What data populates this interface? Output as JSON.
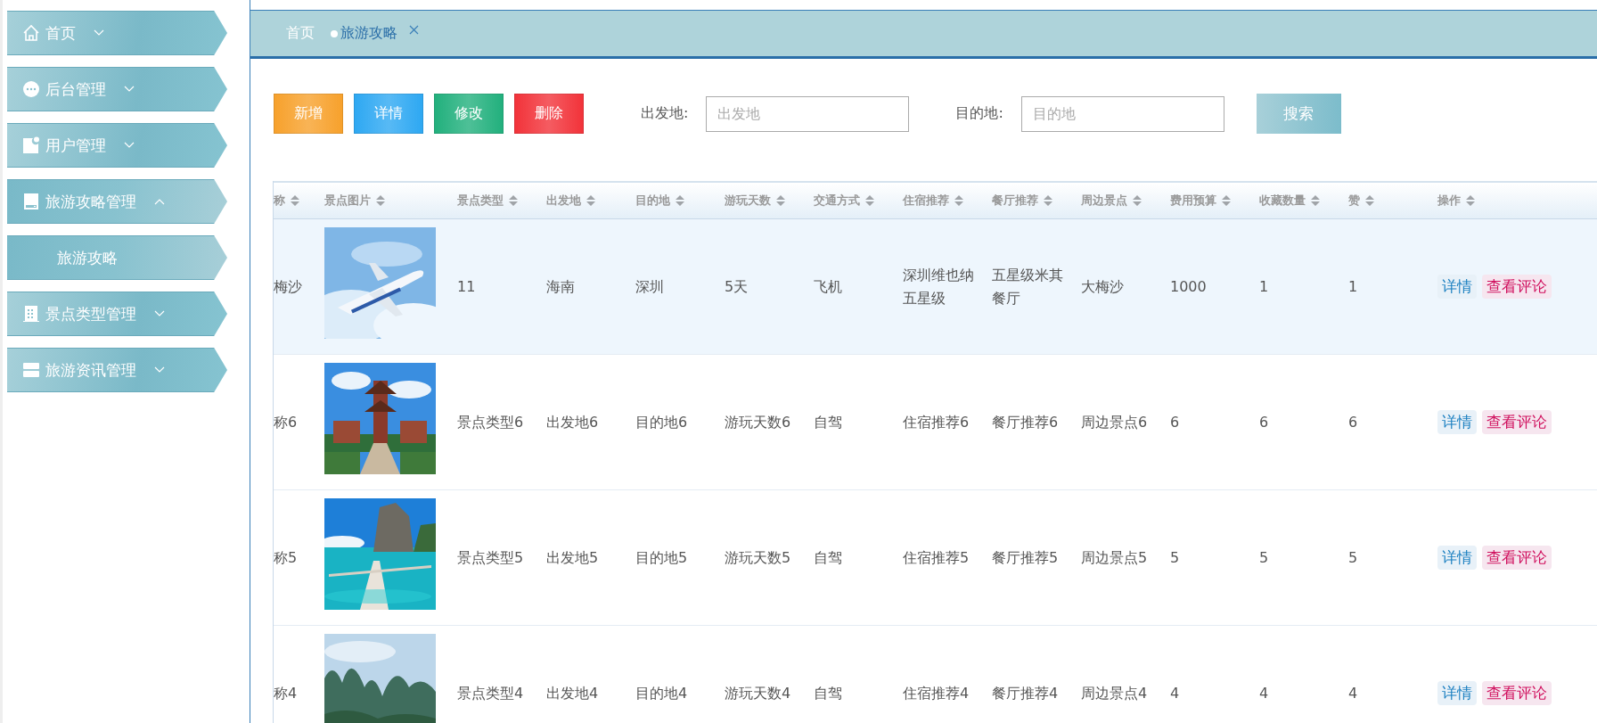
{
  "sidebar": {
    "items": [
      {
        "label": "首页",
        "expanded": false
      },
      {
        "label": "后台管理",
        "expanded": false
      },
      {
        "label": "用户管理",
        "expanded": false
      },
      {
        "label": "旅游攻略管理",
        "expanded": true,
        "children": [
          {
            "label": "旅游攻略",
            "selected": true
          }
        ]
      },
      {
        "label": "景点类型管理",
        "expanded": false
      },
      {
        "label": "旅游资讯管理",
        "expanded": false
      }
    ]
  },
  "tabs": [
    {
      "label": "首页",
      "selected": false,
      "closable": false
    },
    {
      "label": "旅游攻略",
      "selected": true,
      "closable": true
    }
  ],
  "toolbar": {
    "buttons": [
      {
        "label": "新增",
        "color": "#f7a12c"
      },
      {
        "label": "详情",
        "color": "#2ea8f2"
      },
      {
        "label": "修改",
        "color": "#22b07d"
      },
      {
        "label": "删除",
        "color": "#f2333a"
      }
    ],
    "filters": [
      {
        "label": "出发地:",
        "placeholder": "出发地"
      },
      {
        "label": "目的地:",
        "placeholder": "目的地"
      }
    ],
    "search_button": "搜索"
  },
  "table": {
    "columns": [
      "称",
      "景点图片",
      "景点类型",
      "出发地",
      "目的地",
      "游玩天数",
      "交通方式",
      "住宿推荐",
      "餐厅推荐",
      "周边景点",
      "费用预算",
      "收藏数量",
      "赞",
      "操作"
    ],
    "rows": [
      {
        "selected": true,
        "cells": [
          "梅沙",
          {
            "kind": "picture"
          },
          "11",
          "海南",
          "深圳",
          "5天",
          "飞机",
          "深圳维也纳五星级",
          "五星级米其餐厅",
          "大梅沙",
          "1000",
          "1",
          "1",
          {
            "actions": [
              "详情",
              "查看评论"
            ]
          }
        ]
      },
      {
        "selected": false,
        "cells": [
          "称6",
          {
            "kind": "picture"
          },
          "景点类型6",
          "出发地6",
          "目的地6",
          "游玩天数6",
          "自驾",
          "住宿推荐6",
          "餐厅推荐6",
          "周边景点6",
          "6",
          "6",
          "6",
          {
            "actions": [
              "详情",
              "查看评论"
            ]
          }
        ]
      },
      {
        "selected": false,
        "cells": [
          "称5",
          {
            "kind": "picture"
          },
          "景点类型5",
          "出发地5",
          "目的地5",
          "游玩天数5",
          "自驾",
          "住宿推荐5",
          "餐厅推荐5",
          "周边景点5",
          "5",
          "5",
          "5",
          {
            "actions": [
              "详情",
              "查看评论"
            ]
          }
        ]
      },
      {
        "selected": false,
        "cells": [
          "称4",
          {
            "kind": "picture"
          },
          "景点类型4",
          "出发地4",
          "目的地4",
          "游玩天数4",
          "自驾",
          "住宿推荐4",
          "餐厅推荐4",
          "周边景点4",
          "4",
          "4",
          "4",
          {
            "actions": [
              "详情",
              "查看评论"
            ]
          }
        ]
      }
    ]
  }
}
